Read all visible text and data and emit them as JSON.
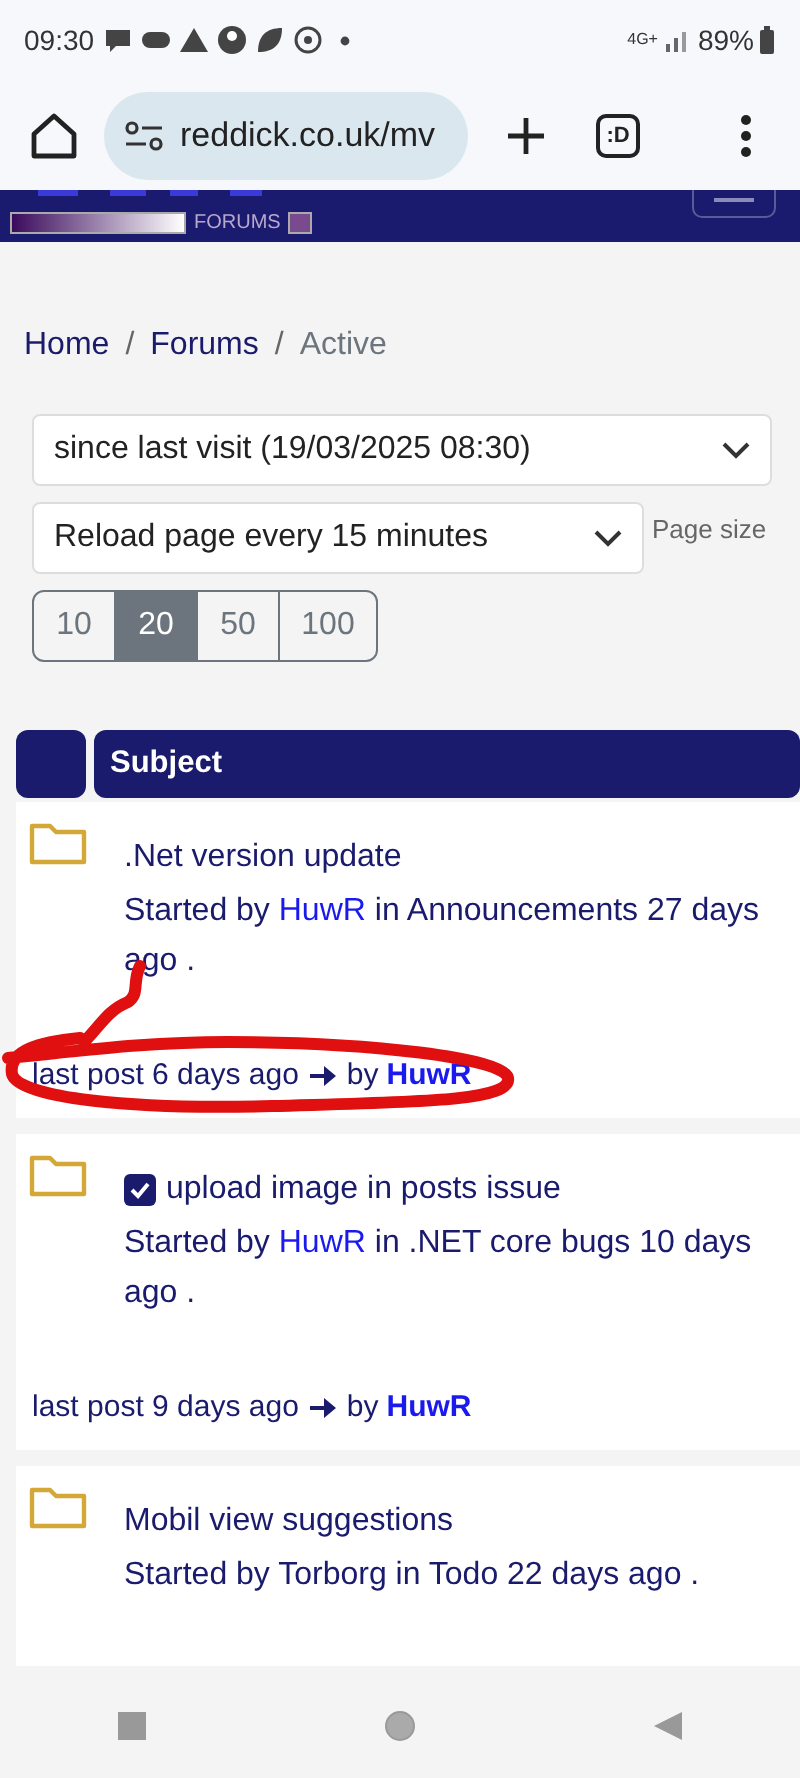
{
  "status_bar": {
    "time": "09:30",
    "network": "4G+",
    "battery": "89%"
  },
  "browser": {
    "url": "reddick.co.uk/mv",
    "tabs_label": ":D"
  },
  "header": {
    "logo_text": "FORUMS"
  },
  "breadcrumb_separator": "/",
  "breadcrumb": [
    {
      "label": "Home",
      "kind": "link"
    },
    {
      "label": "Forums",
      "kind": "link"
    },
    {
      "label": "Active",
      "kind": "current"
    }
  ],
  "filters": {
    "since": "since last visit (19/03/2025 08:30)",
    "reload": "Reload page every 15 minutes",
    "page_size_label": "Page size"
  },
  "page_sizes": [
    {
      "label": "10",
      "selected": false
    },
    {
      "label": "20",
      "selected": true
    },
    {
      "label": "50",
      "selected": false
    },
    {
      "label": "100",
      "selected": false
    }
  ],
  "table": {
    "columns": [
      "",
      "Subject"
    ],
    "topics": [
      {
        "title": ".Net version update",
        "marked": false,
        "highlighted": true,
        "started": [
          {
            "text": "Started by ",
            "kind": "text"
          },
          {
            "text": "HuwR",
            "kind": "link"
          },
          {
            "text": " in Announcements 27 days ago .",
            "kind": "text"
          }
        ],
        "last_post": {
          "text": "last post 6 days ago",
          "by": "by",
          "author": "HuwR"
        }
      },
      {
        "title": "upload image in posts issue",
        "marked": true,
        "highlighted": false,
        "started": [
          {
            "text": "Started by ",
            "kind": "text"
          },
          {
            "text": "HuwR",
            "kind": "link"
          },
          {
            "text": " in .NET core bugs 10 days ago .",
            "kind": "text"
          }
        ],
        "last_post": {
          "text": "last post 9 days ago",
          "by": "by",
          "author": "HuwR"
        }
      },
      {
        "title": "Mobil view suggestions",
        "marked": false,
        "highlighted": false,
        "started": [
          {
            "text": "Started by Torborg in Todo 22 days ago .",
            "kind": "text"
          }
        ]
      }
    ]
  }
}
